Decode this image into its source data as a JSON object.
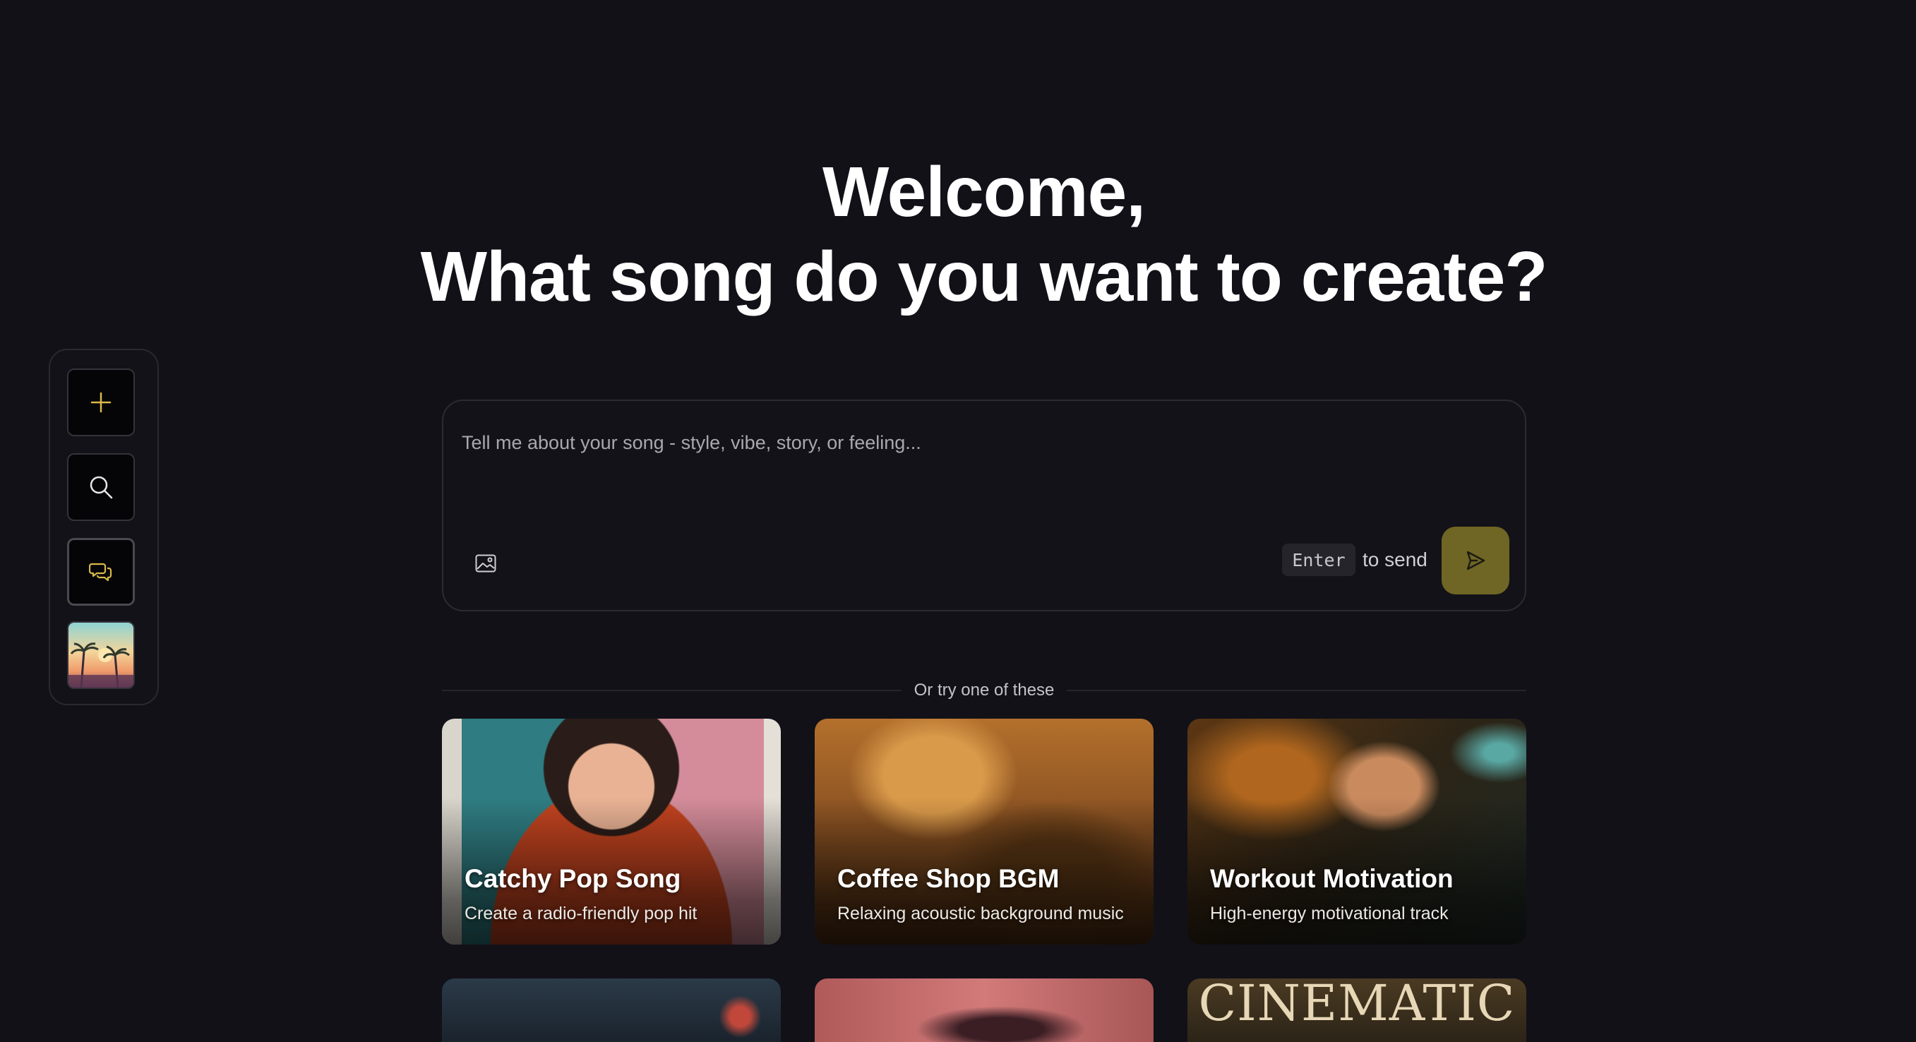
{
  "sidebar": {
    "new_icon": "plus-icon",
    "search_icon": "search-icon",
    "chat_icon": "chat-bubbles-icon",
    "accent": "#d9b94a"
  },
  "heading": {
    "line1": "Welcome,",
    "line2": "What song do you want to create?"
  },
  "composer": {
    "placeholder": "Tell me about your song - style, vibe, story, or feeling...",
    "value": "",
    "image_icon": "image-icon",
    "key_hint": "Enter",
    "send_hint": "to send",
    "send_icon": "send-icon",
    "send_color": "#6f6524"
  },
  "suggestions": {
    "label": "Or try one of these",
    "cards": [
      {
        "title": "Catchy Pop Song",
        "subtitle": "Create a radio-friendly pop hit"
      },
      {
        "title": "Coffee Shop BGM",
        "subtitle": "Relaxing acoustic background music"
      },
      {
        "title": "Workout Motivation",
        "subtitle": "High-energy motivational track"
      }
    ],
    "partial_cards": [
      {
        "text": ""
      },
      {
        "text": ""
      },
      {
        "text": "CINEMATIC"
      }
    ]
  }
}
